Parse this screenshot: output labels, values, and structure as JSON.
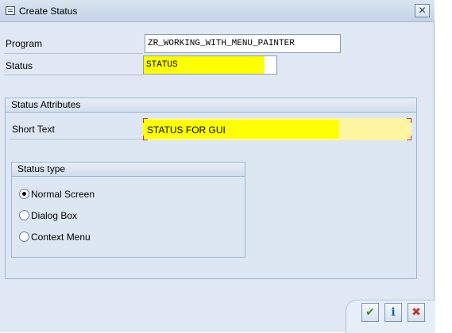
{
  "window": {
    "title": "Create Status",
    "close_symbol": "✕"
  },
  "form": {
    "program_label": "Program",
    "program_value": "ZR_WORKING_WITH_MENU_PAINTER",
    "status_label": "Status",
    "status_value": "STATUS"
  },
  "attributes": {
    "group_title": "Status Attributes",
    "short_text_label": "Short Text",
    "short_text_value": "STATUS FOR GUI",
    "status_type": {
      "group_title": "Status type",
      "options": [
        {
          "label": "Normal Screen",
          "selected": true
        },
        {
          "label": "Dialog Box",
          "selected": false
        },
        {
          "label": "Context Menu",
          "selected": false
        }
      ]
    }
  },
  "footer": {
    "buttons": [
      {
        "name": "confirm",
        "symbol": "✔",
        "color": "#3a8f1c"
      },
      {
        "name": "info",
        "symbol": "i",
        "color": "#1f5fa8"
      },
      {
        "name": "cancel",
        "symbol": "✖",
        "color": "#c0392b"
      }
    ]
  },
  "colors": {
    "highlight": "#ffff00",
    "required_bg": "#fff5a0",
    "panel_bg": "#dfe8f3"
  }
}
